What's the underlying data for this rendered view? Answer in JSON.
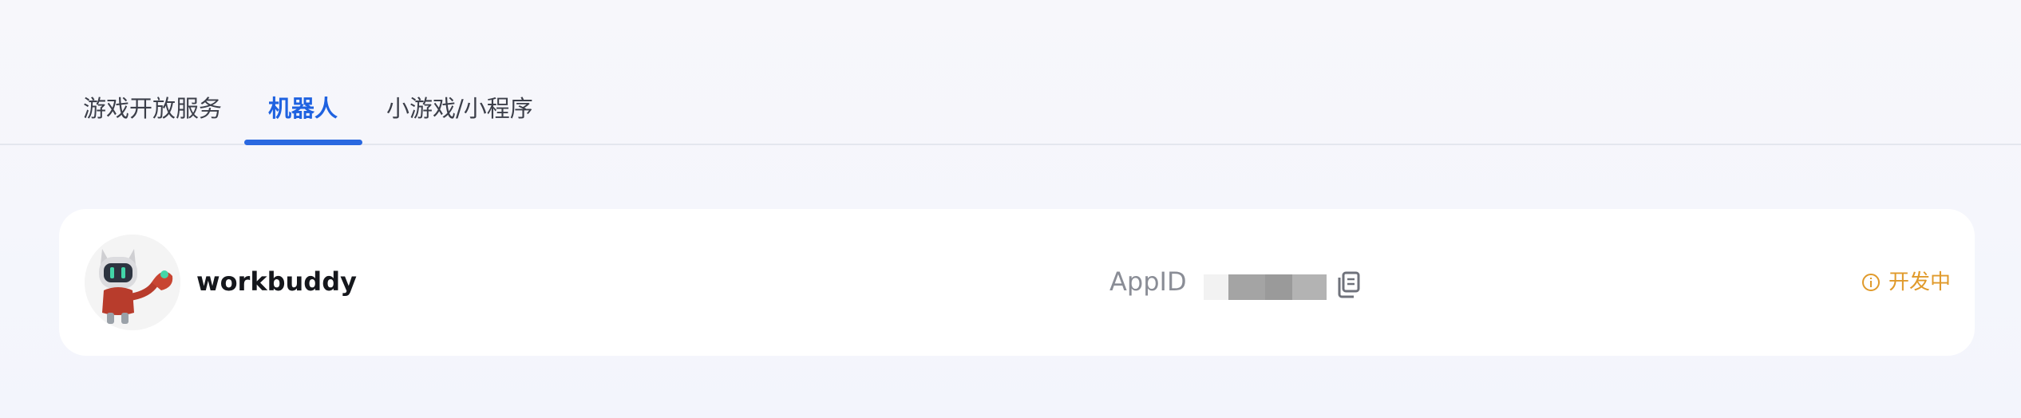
{
  "tabs": [
    {
      "label": "游戏开放服务",
      "active": false
    },
    {
      "label": "机器人",
      "active": true
    },
    {
      "label": "小游戏/小程序",
      "active": false
    }
  ],
  "bot": {
    "name": "workbuddy",
    "appid_label": "AppID",
    "appid_value_redacted": true,
    "status": "开发中",
    "status_icon": "info-icon",
    "copy_icon": "copy-icon"
  },
  "colors": {
    "active_tab": "#1f62e0",
    "status": "#e09a2b",
    "page_bg": "#f3f5fc",
    "card_bg": "#ffffff"
  }
}
